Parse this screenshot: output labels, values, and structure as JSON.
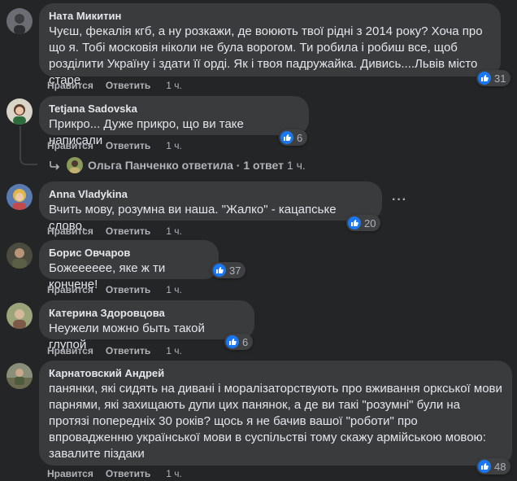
{
  "comments": [
    {
      "author": "Ната Микитин",
      "text": "Чуєш, фекалія кгб, а ну розкажи, де воюють твої рідні з 2014 року? Хоча про що я. Тобі московія ніколи не була ворогом. Ти робила і робиш все, щоб розділити Україну і здати її орді. Як і твоя падружайка. Дивись....Львів місто старе",
      "like_label": "Нравится",
      "reply_label": "Ответить",
      "time": "1 ч.",
      "reactions": "31"
    },
    {
      "author": "Tetjana Sadovska",
      "text": "Прикро... Дуже прикро, що ви таке написали",
      "like_label": "Нравится",
      "reply_label": "Ответить",
      "time": "1 ч.",
      "reactions": "6",
      "replies": {
        "text": "Ольга Панченко ответила · 1 ответ",
        "time": "1 ч."
      }
    },
    {
      "author": "Anna Vladykina",
      "text": "Вчить мову, розумна ви наша. \"Жалко\" - кацапське слово.",
      "like_label": "Нравится",
      "reply_label": "Ответить",
      "time": "1 ч.",
      "reactions": "20",
      "more": "···"
    },
    {
      "author": "Борис Овчаров",
      "text": "Божееееее, яке ж ти кончене!",
      "like_label": "Нравится",
      "reply_label": "Ответить",
      "time": "1 ч.",
      "reactions": "37"
    },
    {
      "author": "Катерина Здоровцова",
      "text": "Неужели можно быть такой глупой",
      "like_label": "Нравится",
      "reply_label": "Ответить",
      "time": "1 ч.",
      "reactions": "6"
    },
    {
      "author": "Карнатовский Андрей",
      "text": "панянки, які сидять на дивані і моралізаторствують про вживання оркської мови парнями, які захищають дупи цих панянок, а де ви такі \"розумні\" були на протязі попередніх 30 років? щось я не бачив вашої \"роботи\" про впровадженню української мови в суспільстві тому скажу армійською мовою: завалите піздаки",
      "like_label": "Нравится",
      "reply_label": "Ответить",
      "time": "1 ч.",
      "reactions": "48"
    }
  ],
  "colors": {
    "background": "#242526",
    "bubble": "#3a3b3c",
    "like": "#1877f2",
    "muted": "#b0b3b8"
  },
  "icons": {
    "reaction": "thumbs-up-icon",
    "reply_arrow": "reply-arrow-icon",
    "more": "more-options-icon"
  }
}
